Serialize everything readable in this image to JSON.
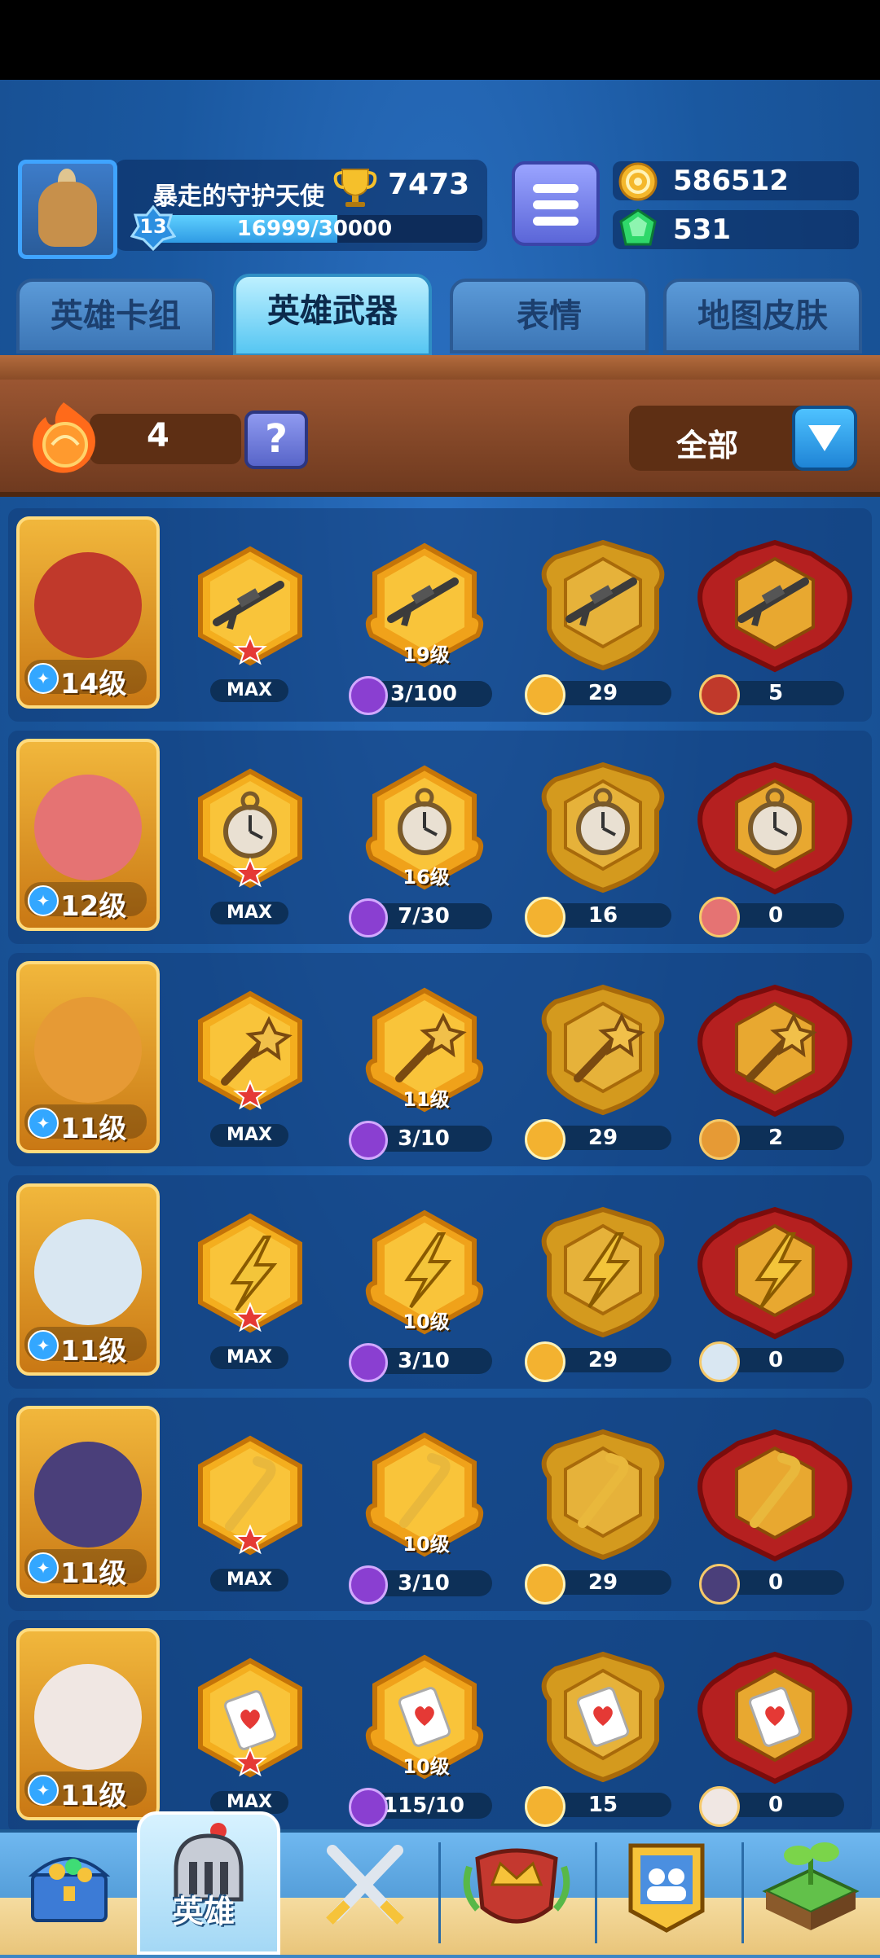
{
  "player": {
    "name": "暴走的守护天使",
    "trophies": "7473",
    "level": "13",
    "xp_text": "16999/30000",
    "xp_fraction": 0.567
  },
  "currency": {
    "coins": "586512",
    "gems": "531"
  },
  "tabs": [
    {
      "label": "英雄卡组",
      "active": false
    },
    {
      "label": "英雄武器",
      "active": true
    },
    {
      "label": "表情",
      "active": false
    },
    {
      "label": "地图皮肤",
      "active": false
    }
  ],
  "toolbar": {
    "fire_count": "4",
    "help_label": "?",
    "filter_label": "全部"
  },
  "heroes": [
    {
      "level": "14级",
      "weapon": "rifle",
      "max_label": "MAX",
      "weapon_level": "19级",
      "progress": "3/100",
      "gold_shards": "29",
      "red_shards": "5",
      "color": "#c0392b"
    },
    {
      "level": "12级",
      "weapon": "pocket-watch",
      "max_label": "MAX",
      "weapon_level": "16级",
      "progress": "7/30",
      "gold_shards": "16",
      "red_shards": "0",
      "color": "#e57373"
    },
    {
      "level": "11级",
      "weapon": "mace",
      "max_label": "MAX",
      "weapon_level": "11级",
      "progress": "3/10",
      "gold_shards": "29",
      "red_shards": "2",
      "color": "#e69a35"
    },
    {
      "level": "11级",
      "weapon": "lightning",
      "max_label": "MAX",
      "weapon_level": "10级",
      "progress": "3/10",
      "gold_shards": "29",
      "red_shards": "0",
      "color": "#d9e7f2"
    },
    {
      "level": "11级",
      "weapon": "crowbar",
      "max_label": "MAX",
      "weapon_level": "10级",
      "progress": "3/10",
      "gold_shards": "29",
      "red_shards": "0",
      "color": "#4a3f7a"
    },
    {
      "level": "11级",
      "weapon": "heart-card",
      "max_label": "MAX",
      "weapon_level": "10级",
      "progress": "115/10",
      "gold_shards": "15",
      "red_shards": "0",
      "color": "#f0e7e3"
    }
  ],
  "nav": {
    "active_label": "英雄",
    "items": [
      "treasure-chest-icon",
      "hero-helmet-icon",
      "crossed-swords-icon",
      "crown-shield-icon",
      "team-banner-icon",
      "island-sprout-icon"
    ]
  }
}
